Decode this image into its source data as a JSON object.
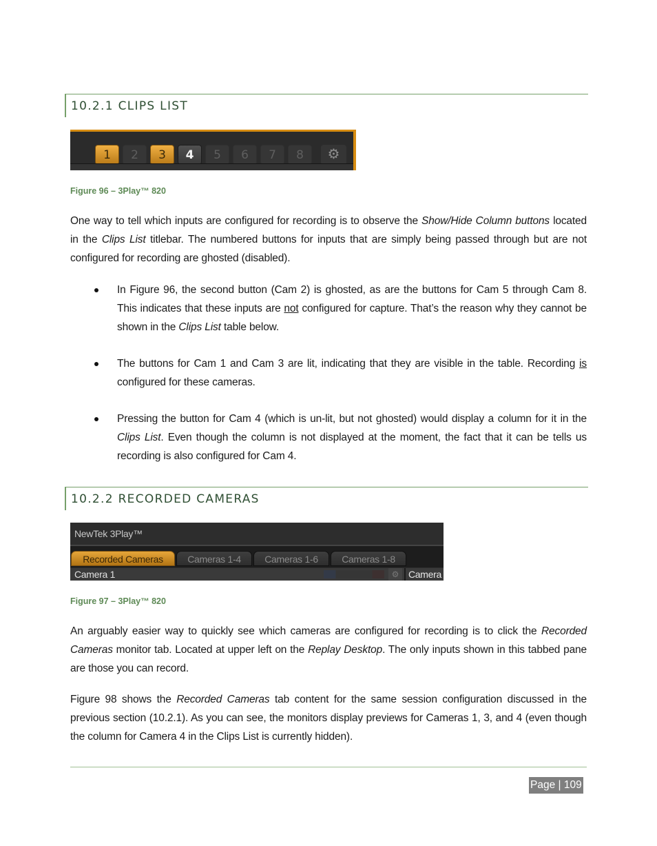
{
  "section1": {
    "heading": "10.2.1 CLIPS LIST",
    "figure": {
      "caption": "Figure 96 – 3Play™ 820",
      "buttons": [
        {
          "label": "1",
          "state": "lit"
        },
        {
          "label": "2",
          "state": "ghosted"
        },
        {
          "label": "3",
          "state": "lit"
        },
        {
          "label": "4",
          "state": "unlit"
        },
        {
          "label": "5",
          "state": "ghosted"
        },
        {
          "label": "6",
          "state": "ghosted"
        },
        {
          "label": "7",
          "state": "ghosted"
        },
        {
          "label": "8",
          "state": "ghosted"
        }
      ],
      "settings_icon": "gear-icon",
      "accent_color": "#d68c12"
    },
    "para1": {
      "a": "One way to tell which inputs are configured for recording is to observe the ",
      "b": "Show/Hide Column buttons",
      "c": " located in the ",
      "d": "Clips List",
      "e": " titlebar.  The numbered buttons for inputs that are simply being passed through but are not configured for recording are ghosted (disabled)."
    },
    "bullets": [
      {
        "a": "In Figure 96, the second button (Cam 2) is ghosted, as are the buttons for Cam 5 through Cam 8.  This indicates that these inputs are ",
        "u": "not",
        "b": " configured for capture.  That’s the reason why they cannot be shown in the ",
        "i": "Clips List",
        "c": " table below."
      },
      {
        "a": "The buttons for Cam 1 and Cam 3 are lit, indicating that they are visible in the table. Recording ",
        "u": "is",
        "b": " configured for these cameras."
      },
      {
        "a": "Pressing the button for Cam 4 (which is un-lit, but not ghosted) would display a column for it in the ",
        "i": "Clips List",
        "b": ".  Even though the column is not displayed at the moment, the fact that it can be tells us recording is also configured for Cam 4."
      }
    ]
  },
  "section2": {
    "heading": "10.2.2 RECORDED CAMERAS",
    "figure": {
      "caption": "Figure 97  – 3Play™ 820",
      "app_title": "NewTek 3Play™",
      "tabs": [
        {
          "label": "Recorded Cameras",
          "active": true
        },
        {
          "label": "Cameras 1-4",
          "active": false
        },
        {
          "label": "Cameras 1-6",
          "active": false
        },
        {
          "label": "Cameras 1-8",
          "active": false
        }
      ],
      "monitor_label_1": "Camera 1",
      "monitor_label_2": "Camera"
    },
    "para1": {
      "a": "An arguably easier way to quickly see which cameras are configured for recording is to click the ",
      "b": "Recorded Cameras",
      "c": " monitor tab. Located at upper left on the ",
      "d": "Replay Desktop",
      "e": ".  The only inputs shown in this tabbed pane are those you can record."
    },
    "para2": {
      "a": "Figure 98 shows the ",
      "b": "Recorded Cameras",
      "c": " tab content for the same session configuration discussed in the previous section (10.2.1).  As you can see, the monitors display previews for Cameras 1, 3, and 4 (even though the column for Camera 4 in the Clips List is currently hidden)."
    }
  },
  "footer": {
    "page_label": "Page | 109"
  },
  "colors": {
    "heading_rule": "#76a06a",
    "heading_text": "#2f4f33",
    "caption_text": "#5e8a56",
    "page_badge_bg": "#7f7f7f"
  }
}
